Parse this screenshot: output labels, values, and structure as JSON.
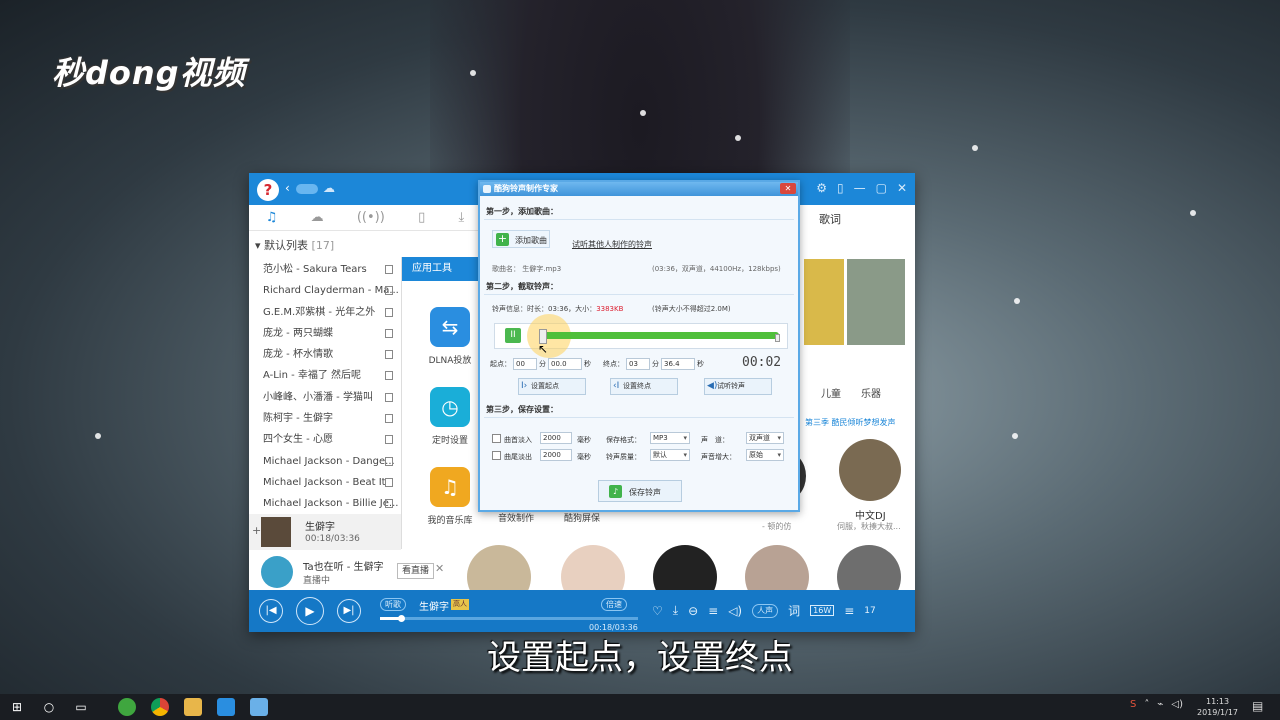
{
  "watermark": "秒dong视频",
  "subtitle": "设置起点，设置终点",
  "app": {
    "playlist_header": "默认列表",
    "playlist_count": "[17]",
    "playlist": [
      "范小松 - Sakura Tears",
      "Richard Clayderman - Ma...",
      "G.E.M.邓紫棋 - 光年之外",
      "庞龙 - 两只蝴蝶",
      "庞龙 - 杯水情歌",
      "A-Lin - 幸福了 然后呢",
      "小峰峰、小潘潘 - 学猫叫",
      "陈柯宇 - 生僻字",
      "四个女生 - 心愿",
      "Michael Jackson - Dange...",
      "Michael Jackson - Beat It",
      "Michael Jackson - Billie Je..."
    ],
    "now_playing": {
      "title": "生僻字",
      "time": "00:18/03:36"
    },
    "live": {
      "title": "Ta也在听 - 生僻字",
      "sub": "直播中",
      "button": "看直播"
    },
    "tools_header": "应用工具",
    "tools": [
      {
        "label": "DLNA投放",
        "icon": "dlna-icon"
      },
      {
        "label": "定时设置",
        "icon": "clock-icon"
      },
      {
        "label": "我的音乐库",
        "icon": "music-library-icon"
      },
      {
        "label": "音效制作",
        "icon": "sound-effect-icon"
      },
      {
        "label": "酷狗屏保",
        "icon": "screensaver-icon"
      }
    ],
    "lyrics_tab": "歌词",
    "categories": [
      "儿童",
      "乐器"
    ],
    "banner": "第三季 酷民倾听梦想发声",
    "disc_dj_label": "中文DJ",
    "disc_dj_sub": "伺服，秋揍大叔...",
    "left_sub": "- 顿的仿",
    "player": {
      "mode": "听歌",
      "title": "生僻字",
      "badge": "高人",
      "speed": "倍速",
      "time": "00:18/03:36",
      "progress": 0.083,
      "listen": "人声",
      "lyrics_btn": "词",
      "quality": "16W",
      "count": "17"
    },
    "accent": "#1c87d8"
  },
  "dialog": {
    "title": "酷狗铃声制作专家",
    "close": "✕",
    "step1": "第一步，添加歌曲：",
    "add_song": "添加歌曲",
    "link": "试听其他人制作的铃声",
    "song_name": "歌曲名：  生僻字.mp3",
    "song_info": "(03:36，双声道，44100Hz，128kbps)",
    "step2": "第二步，截取铃声：",
    "ring_info_prefix": "铃声信息：时长：03:36，大小：",
    "ring_size": "3383KB",
    "ring_limit": "(铃声大小不得超过2.0M)",
    "start_label": "起点：",
    "start_min": "00",
    "start_sec_unit": "分",
    "start_sec": "00.0",
    "sec_unit": "秒",
    "end_label": "终点：",
    "end_min": "03",
    "end_sec": "36.4",
    "elapsed": "00:02",
    "set_start": "设置起点",
    "set_end": "设置终点",
    "preview": "试听铃声",
    "step3": "第三步，保存设置：",
    "fade_in": "曲首淡入",
    "fade_in_ms": "2000",
    "fade_out": "曲尾淡出",
    "fade_out_ms": "2000",
    "ms_unit": "毫秒",
    "format_label": "保存格式：",
    "format": "MP3",
    "quality_label": "铃声质量：",
    "quality": "默认",
    "channel_label": "声　道：",
    "channel": "双声道",
    "volume_label": "声音增大：",
    "volume": "原始",
    "save": "保存铃声"
  },
  "taskbar": {
    "time": "11:13",
    "date": "2019/1/17"
  }
}
